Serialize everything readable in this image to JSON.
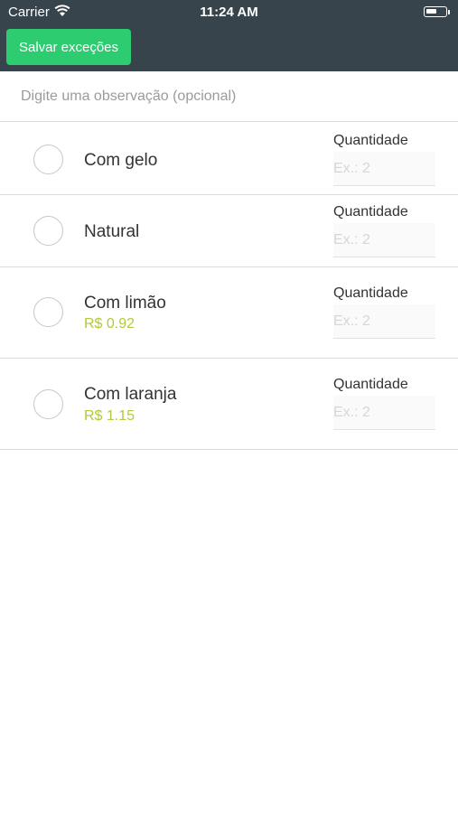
{
  "status_bar": {
    "carrier": "Carrier",
    "time": "11:24 AM"
  },
  "header": {
    "save_label": "Salvar exceções"
  },
  "observation": {
    "placeholder": "Digite uma observação (opcional)",
    "value": ""
  },
  "options": [
    {
      "name": "Com gelo",
      "price": "",
      "quantity_label": "Quantidade",
      "quantity_placeholder": "Ex.: 2"
    },
    {
      "name": "Natural",
      "price": "",
      "quantity_label": "Quantidade",
      "quantity_placeholder": "Ex.: 2"
    },
    {
      "name": "Com limão",
      "price": "R$ 0.92",
      "quantity_label": "Quantidade",
      "quantity_placeholder": "Ex.: 2"
    },
    {
      "name": "Com laranja",
      "price": "R$ 1.15",
      "quantity_label": "Quantidade",
      "quantity_placeholder": "Ex.: 2"
    }
  ],
  "colors": {
    "header_bg": "#37444b",
    "save_button": "#2ecc71",
    "price": "#b5c73a"
  }
}
